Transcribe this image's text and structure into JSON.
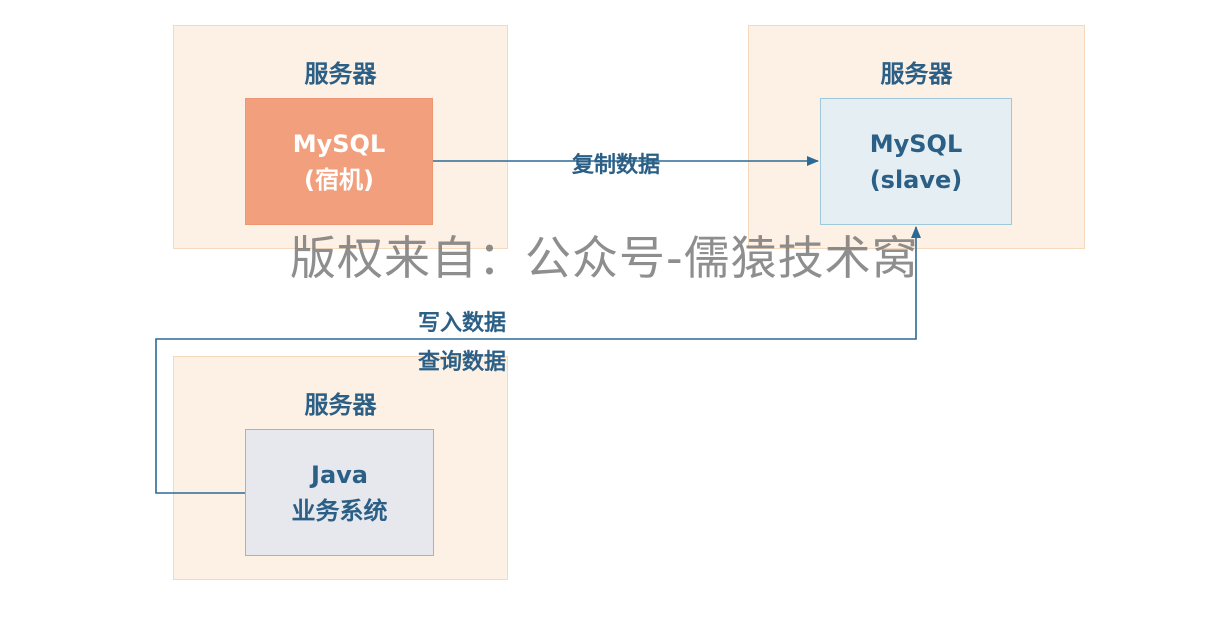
{
  "diagram": {
    "server_top_left": {
      "title": "服务器",
      "node": {
        "line1": "MySQL",
        "line2": "(宿机)"
      }
    },
    "server_top_right": {
      "title": "服务器",
      "node": {
        "line1": "MySQL",
        "line2": "(slave)"
      }
    },
    "server_bottom": {
      "title": "服务器",
      "node": {
        "line1": "Java",
        "line2": "业务系统"
      }
    },
    "edges": {
      "replicate_label": "复制数据",
      "write_label": "写入数据",
      "query_label": "查询数据"
    },
    "colors": {
      "server_fill": "#fdf0e4",
      "master_fill": "#f19f7c",
      "slave_fill": "#e4eef3",
      "app_fill": "#e6e8ee",
      "edge": "#2b6a96"
    }
  },
  "watermark": "版权来自：公众号-儒猿技术窝"
}
